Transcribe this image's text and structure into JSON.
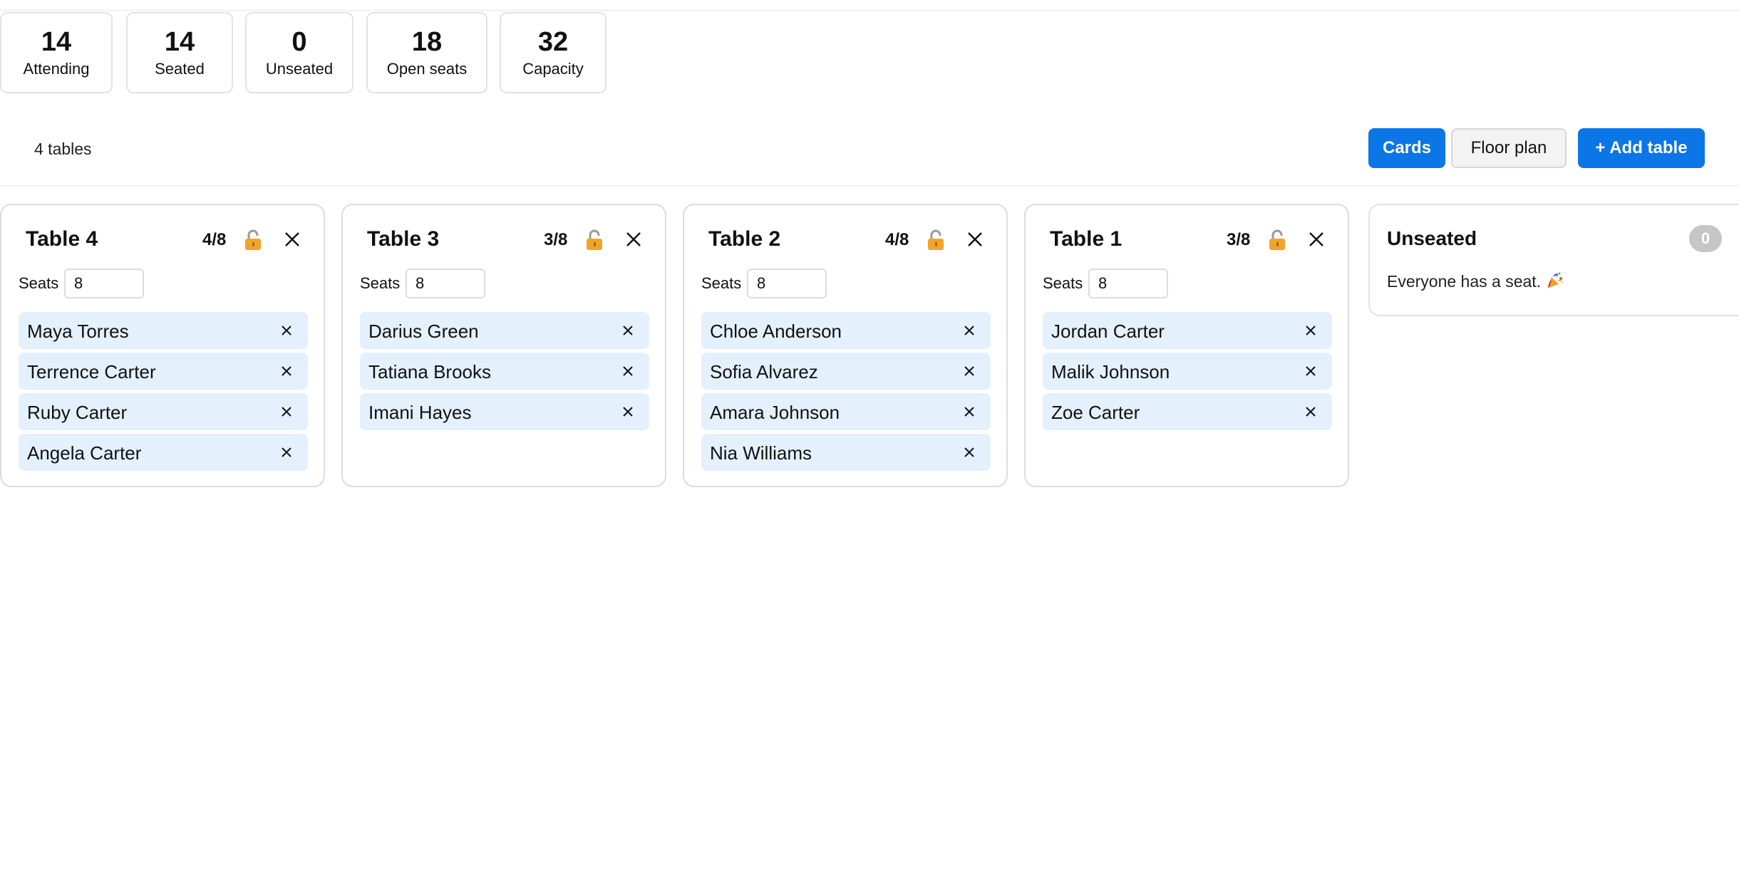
{
  "stats": [
    {
      "value": "14",
      "label": "Attending"
    },
    {
      "value": "14",
      "label": "Seated"
    },
    {
      "value": "0",
      "label": "Unseated"
    },
    {
      "value": "18",
      "label": "Open seats"
    },
    {
      "value": "32",
      "label": "Capacity"
    }
  ],
  "toolbar": {
    "table_count": "4 tables",
    "cards_label": "Cards",
    "floor_plan_label": "Floor plan",
    "add_table_label": "+ Add table"
  },
  "tables": [
    {
      "name": "Table 4",
      "count": "4/8",
      "seats_label": "Seats",
      "seats": "8",
      "guests": [
        "Maya Torres",
        "Terrence Carter",
        "Ruby Carter",
        "Angela Carter"
      ]
    },
    {
      "name": "Table 3",
      "count": "3/8",
      "seats_label": "Seats",
      "seats": "8",
      "guests": [
        "Darius Green",
        "Tatiana Brooks",
        "Imani Hayes"
      ]
    },
    {
      "name": "Table 2",
      "count": "4/8",
      "seats_label": "Seats",
      "seats": "8",
      "guests": [
        "Chloe Anderson",
        "Sofia Alvarez",
        "Amara Johnson",
        "Nia Williams"
      ]
    },
    {
      "name": "Table 1",
      "count": "3/8",
      "seats_label": "Seats",
      "seats": "8",
      "guests": [
        "Jordan Carter",
        "Malik Johnson",
        "Zoe Carter"
      ]
    }
  ],
  "unseated": {
    "title": "Unseated",
    "count": "0",
    "message": "Everyone has a seat."
  },
  "icons": {
    "lock": "open-lock-icon",
    "close": "close-icon",
    "remove": "remove-guest-icon",
    "party": "party-popper-icon"
  },
  "colors": {
    "primary": "#0b76e6",
    "guest_chip": "#e4f0fc",
    "badge": "#c6c6c6",
    "border": "#dcdcdc"
  }
}
